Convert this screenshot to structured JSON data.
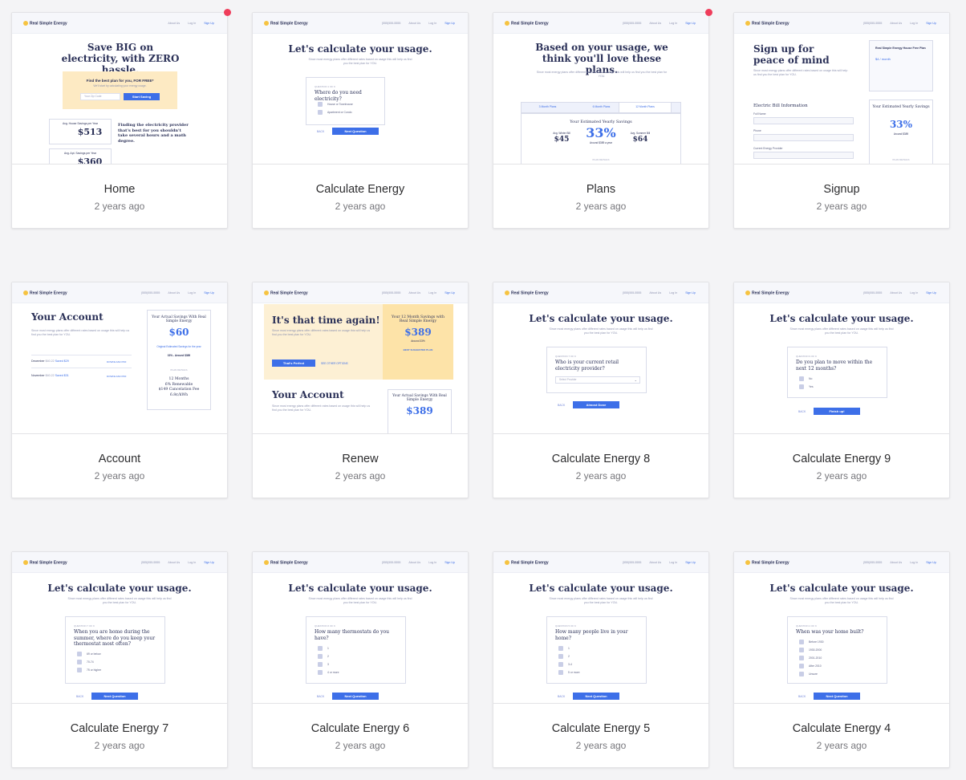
{
  "cards": [
    {
      "title": "Home",
      "date": "2 years ago",
      "badge": true
    },
    {
      "title": "Calculate Energy",
      "date": "2 years ago",
      "badge": false
    },
    {
      "title": "Plans",
      "date": "2 years ago",
      "badge": true
    },
    {
      "title": "Signup",
      "date": "2 years ago",
      "badge": false
    },
    {
      "title": "Account",
      "date": "2 years ago",
      "badge": false
    },
    {
      "title": "Renew",
      "date": "2 years ago",
      "badge": false
    },
    {
      "title": "Calculate Energy 8",
      "date": "2 years ago",
      "badge": false
    },
    {
      "title": "Calculate Energy 9",
      "date": "2 years ago",
      "badge": false
    },
    {
      "title": "Calculate Energy 7",
      "date": "2 years ago",
      "badge": false
    },
    {
      "title": "Calculate Energy 6",
      "date": "2 years ago",
      "badge": false
    },
    {
      "title": "Calculate Energy 5",
      "date": "2 years ago",
      "badge": false
    },
    {
      "title": "Calculate Energy 4",
      "date": "2 years ago",
      "badge": false
    }
  ],
  "mock": {
    "brand": "Real Simple Energy",
    "nav": {
      "phone": "(555)555-5555",
      "about": "About Us",
      "login": "Log In",
      "signup": "Sign Up"
    },
    "calc_title": "Let's calculate your usage.",
    "calc_sub": "Since most energy plans offer different rates based on usage this will help us find you the best plan for YOU.",
    "back": "BACK",
    "next": "Next Question",
    "home": {
      "headline": "Save BIG on electricity, with ZERO hassle.",
      "find": "Find the best plan for you, FOR FREE*",
      "find_sub": "We'll start by calculating your energy usage.",
      "zip_placeholder": "Your Zip Code",
      "start": "Start Saving",
      "house_label": "Avg. House Savings per Year",
      "house_value": "$513",
      "apt_label": "Avg. Apt. Savings per Year",
      "apt_value": "$360",
      "side_title": "Finding the electricity provider that's best for you shouldn't take several hours and a math degree."
    },
    "calc1": {
      "qnum": "QUESTION 1 OF 9",
      "question": "Where do you need electricity?",
      "options": [
        "House or Townhouse",
        "Apartment or Condo"
      ]
    },
    "plans": {
      "headline": "Based on your usage, we think you'll love these plans.",
      "tabs": [
        "3 Month Plans",
        "6 Month Plans",
        "12 Month Plans"
      ],
      "est": "Your Estimated Yearly Savings",
      "winter_label": "Avg. Winter Bill",
      "winter": "$45",
      "pct": "33%",
      "pct_sub": "Around $389 a year",
      "summer_label": "Avg. Summer Bill",
      "summer": "$64",
      "details": "PLAN DETAILS"
    },
    "signup": {
      "headline": "Sign up for peace of mind",
      "section": "Electric Bill Information",
      "fields": [
        "Full Name",
        "Phone",
        "Current Energy Provider"
      ],
      "plan_name": "Real Simple Energy House Free Plan",
      "plan_price": "$4 / month",
      "est": "Your Estimated Yearly Savings",
      "pct": "33%",
      "around": "Around $389",
      "details": "PLAN DETAILS"
    },
    "account": {
      "headline": "Your Account",
      "rows": [
        {
          "month": "December",
          "amount": "$40.22",
          "saved": "Saved $29",
          "link": "DOWNLOAD PDF"
        },
        {
          "month": "November",
          "amount": "$40.22",
          "saved": "Saved $31",
          "link": "DOWNLOAD PDF"
        }
      ],
      "actual": "Your Actual Savings With Real Simple Energy",
      "actual_value": "$60",
      "orig": "Original Estimated Savings for the year",
      "orig_value": "33% - Around $389",
      "plan_details": "PLAN DETAILS",
      "plan_lines": [
        "12 Months",
        "6% Renewable",
        "$149 Cancelation Fee",
        "6.8¢/kWh"
      ]
    },
    "renew": {
      "headline": "It's that time again!",
      "perfect": "That's Perfect",
      "other": "SEE OTHER OPTIONS",
      "side_title": "Your 12 Month Savings with Real Simple Energy",
      "side_value": "$389",
      "side_sub": "Around 33%",
      "suggested": "BEST SUGGESTED PLAN",
      "account": "Your Account",
      "actual": "Your Actual Savings With Real Simple Energy",
      "actual_value": "$389"
    },
    "calc8": {
      "qnum": "QUESTION 7 OF 9",
      "question": "Who is your current retail electricity provider?",
      "select": "Select Provider",
      "next": "Almost Done"
    },
    "calc9": {
      "qnum": "QUESTION 9 OF 9",
      "question": "Do you plan to move within the next 12 months?",
      "options": [
        "No",
        "Yes"
      ],
      "next": "Finish up!"
    },
    "calc7": {
      "qnum": "QUESTION 7 OF 9",
      "question": "When you are home during the summer, where do you keep your thermostat most often?",
      "options": [
        "69 or below",
        "70-74",
        "75 or higher"
      ]
    },
    "calc6": {
      "qnum": "QUESTION 6 OF 9",
      "question": "How many thermostats do you have?",
      "options": [
        "1",
        "2",
        "3",
        "4 or more"
      ]
    },
    "calc5": {
      "qnum": "QUESTION 5 OF 9",
      "question": "How many people live in your home?",
      "options": [
        "1",
        "2",
        "3-4",
        "5 or more"
      ]
    },
    "calc4": {
      "qnum": "QUESTION 4 OF 9",
      "question": "When was your home built?",
      "options": [
        "Before 1930",
        "1930-2000",
        "2001-2010",
        "After 2010",
        "Unsure"
      ]
    }
  },
  "colors": {
    "accent": "#3d6fe8",
    "navy": "#2b3158",
    "badge": "#ef3d5b",
    "highlight": "#fdeac3"
  }
}
